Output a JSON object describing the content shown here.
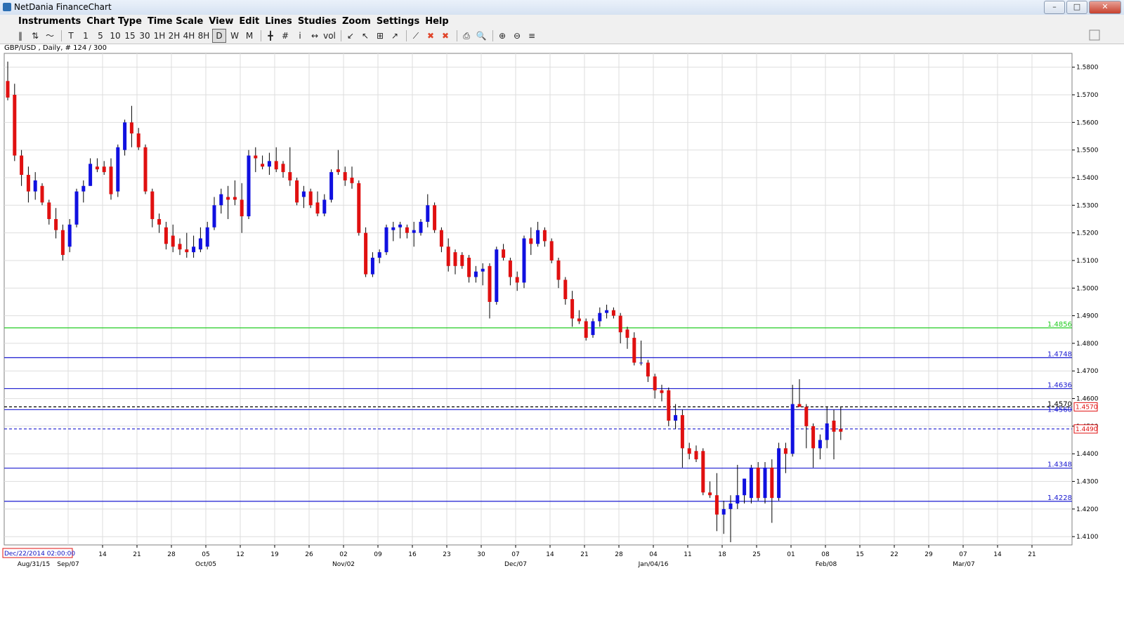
{
  "window": {
    "title": "NetDania FinanceChart",
    "buttons": [
      "–",
      "□",
      "✕"
    ]
  },
  "menu": [
    "Instruments",
    "Chart Type",
    "Time Scale",
    "View",
    "Edit",
    "Lines",
    "Studies",
    "Zoom",
    "Settings",
    "Help"
  ],
  "toolbar": {
    "items": [
      "‖",
      "⇅",
      "〜",
      "|",
      "T",
      "1",
      "5",
      "10",
      "15",
      "30",
      "1H",
      "2H",
      "4H",
      "8H",
      "D",
      "W",
      "M",
      "|",
      "╋",
      "#",
      "i",
      "↔",
      "vol",
      "|",
      "↙",
      "↖",
      "⊞",
      "↗",
      "|",
      "⟋",
      "✖",
      "✖",
      "|",
      "⎙",
      "🔍",
      "|",
      "⊕",
      "⊖",
      "≡"
    ],
    "selected": [
      "D"
    ]
  },
  "symbol_label": "GBP/USD , Daily, # 124 / 300",
  "colors": {
    "up": "#1010e0",
    "down": "#e01010",
    "green": "#22cc22",
    "line": "#1a1ad0",
    "grid": "#dedede"
  },
  "chart_data": {
    "type": "candlestick",
    "y_ticks": [
      "1.5800",
      "1.5700",
      "1.5600",
      "1.5500",
      "1.5400",
      "1.5300",
      "1.5200",
      "1.5100",
      "1.5000",
      "1.4900",
      "1.4800",
      "1.4700",
      "1.4600",
      "1.4500",
      "1.4400",
      "1.4300",
      "1.4200",
      "1.4100"
    ],
    "ylim": [
      1.407,
      1.585
    ],
    "x_tick_labels": [
      "14",
      "21",
      "28",
      "05",
      "12",
      "19",
      "26",
      "02",
      "09",
      "16",
      "23",
      "30",
      "07",
      "14",
      "21",
      "28",
      "04",
      "11",
      "18",
      "25",
      "01",
      "08",
      "15",
      "22",
      "29",
      "07",
      "14",
      "21"
    ],
    "x_period_labels": [
      "Aug/31/15",
      "Sep/07",
      "Oct/05",
      "Nov/02",
      "Dec/07",
      "Jan/04/16",
      "Feb/08",
      "Mar/07"
    ],
    "crosshair_time_label": "Dec/22/2014 02:00:00",
    "horizontal_lines": [
      {
        "value": 1.4856,
        "label": "1.4856",
        "style": "green"
      },
      {
        "value": 1.4748,
        "label": "1.4748",
        "style": "solid"
      },
      {
        "value": 1.4636,
        "label": "1.4636",
        "style": "solid"
      },
      {
        "value": 1.457,
        "label": "1.4570",
        "style": "dashed-black"
      },
      {
        "value": 1.456,
        "label": "1.4560",
        "style": "solid"
      },
      {
        "value": 1.449,
        "label": "1.4490",
        "style": "dashed-blue"
      },
      {
        "value": 1.4348,
        "label": "1.4348",
        "style": "solid"
      },
      {
        "value": 1.4228,
        "label": "1.4228",
        "style": "solid"
      }
    ],
    "price_tags": [
      {
        "value": 1.457,
        "label": "1.4570"
      },
      {
        "value": 1.449,
        "label": "1.4490"
      }
    ],
    "candles": [
      {
        "o": 1.575,
        "h": 1.582,
        "l": 1.568,
        "c": 1.569
      },
      {
        "o": 1.57,
        "h": 1.574,
        "l": 1.546,
        "c": 1.548
      },
      {
        "o": 1.548,
        "h": 1.55,
        "l": 1.537,
        "c": 1.541
      },
      {
        "o": 1.541,
        "h": 1.544,
        "l": 1.531,
        "c": 1.535
      },
      {
        "o": 1.535,
        "h": 1.542,
        "l": 1.532,
        "c": 1.539
      },
      {
        "o": 1.537,
        "h": 1.538,
        "l": 1.53,
        "c": 1.531
      },
      {
        "o": 1.531,
        "h": 1.532,
        "l": 1.523,
        "c": 1.525
      },
      {
        "o": 1.525,
        "h": 1.529,
        "l": 1.518,
        "c": 1.521
      },
      {
        "o": 1.521,
        "h": 1.523,
        "l": 1.51,
        "c": 1.512
      },
      {
        "o": 1.515,
        "h": 1.525,
        "l": 1.513,
        "c": 1.523
      },
      {
        "o": 1.523,
        "h": 1.536,
        "l": 1.522,
        "c": 1.535
      },
      {
        "o": 1.535,
        "h": 1.539,
        "l": 1.531,
        "c": 1.537
      },
      {
        "o": 1.537,
        "h": 1.547,
        "l": 1.537,
        "c": 1.545
      },
      {
        "o": 1.544,
        "h": 1.547,
        "l": 1.542,
        "c": 1.543
      },
      {
        "o": 1.544,
        "h": 1.546,
        "l": 1.541,
        "c": 1.542
      },
      {
        "o": 1.544,
        "h": 1.547,
        "l": 1.532,
        "c": 1.534
      },
      {
        "o": 1.535,
        "h": 1.552,
        "l": 1.533,
        "c": 1.551
      },
      {
        "o": 1.55,
        "h": 1.561,
        "l": 1.548,
        "c": 1.56
      },
      {
        "o": 1.56,
        "h": 1.566,
        "l": 1.551,
        "c": 1.556
      },
      {
        "o": 1.556,
        "h": 1.558,
        "l": 1.55,
        "c": 1.551
      },
      {
        "o": 1.551,
        "h": 1.552,
        "l": 1.534,
        "c": 1.535
      },
      {
        "o": 1.535,
        "h": 1.536,
        "l": 1.522,
        "c": 1.525
      },
      {
        "o": 1.525,
        "h": 1.527,
        "l": 1.52,
        "c": 1.523
      },
      {
        "o": 1.522,
        "h": 1.524,
        "l": 1.514,
        "c": 1.516
      },
      {
        "o": 1.519,
        "h": 1.523,
        "l": 1.513,
        "c": 1.515
      },
      {
        "o": 1.516,
        "h": 1.518,
        "l": 1.512,
        "c": 1.514
      },
      {
        "o": 1.514,
        "h": 1.52,
        "l": 1.511,
        "c": 1.513
      },
      {
        "o": 1.513,
        "h": 1.519,
        "l": 1.511,
        "c": 1.515
      },
      {
        "o": 1.514,
        "h": 1.522,
        "l": 1.513,
        "c": 1.518
      },
      {
        "o": 1.515,
        "h": 1.524,
        "l": 1.514,
        "c": 1.522
      },
      {
        "o": 1.522,
        "h": 1.533,
        "l": 1.521,
        "c": 1.53
      },
      {
        "o": 1.53,
        "h": 1.536,
        "l": 1.527,
        "c": 1.534
      },
      {
        "o": 1.533,
        "h": 1.537,
        "l": 1.525,
        "c": 1.532
      },
      {
        "o": 1.533,
        "h": 1.539,
        "l": 1.53,
        "c": 1.532
      },
      {
        "o": 1.532,
        "h": 1.538,
        "l": 1.52,
        "c": 1.526
      },
      {
        "o": 1.526,
        "h": 1.55,
        "l": 1.525,
        "c": 1.548
      },
      {
        "o": 1.548,
        "h": 1.551,
        "l": 1.542,
        "c": 1.547
      },
      {
        "o": 1.545,
        "h": 1.548,
        "l": 1.543,
        "c": 1.544
      },
      {
        "o": 1.544,
        "h": 1.549,
        "l": 1.541,
        "c": 1.546
      },
      {
        "o": 1.546,
        "h": 1.551,
        "l": 1.542,
        "c": 1.543
      },
      {
        "o": 1.545,
        "h": 1.546,
        "l": 1.54,
        "c": 1.542
      },
      {
        "o": 1.542,
        "h": 1.551,
        "l": 1.537,
        "c": 1.539
      },
      {
        "o": 1.539,
        "h": 1.54,
        "l": 1.53,
        "c": 1.531
      },
      {
        "o": 1.533,
        "h": 1.537,
        "l": 1.529,
        "c": 1.535
      },
      {
        "o": 1.535,
        "h": 1.536,
        "l": 1.529,
        "c": 1.53
      },
      {
        "o": 1.531,
        "h": 1.535,
        "l": 1.526,
        "c": 1.527
      },
      {
        "o": 1.527,
        "h": 1.534,
        "l": 1.526,
        "c": 1.532
      },
      {
        "o": 1.532,
        "h": 1.543,
        "l": 1.531,
        "c": 1.542
      },
      {
        "o": 1.543,
        "h": 1.55,
        "l": 1.541,
        "c": 1.542
      },
      {
        "o": 1.542,
        "h": 1.544,
        "l": 1.537,
        "c": 1.539
      },
      {
        "o": 1.54,
        "h": 1.544,
        "l": 1.536,
        "c": 1.538
      },
      {
        "o": 1.538,
        "h": 1.539,
        "l": 1.519,
        "c": 1.52
      },
      {
        "o": 1.52,
        "h": 1.522,
        "l": 1.504,
        "c": 1.505
      },
      {
        "o": 1.505,
        "h": 1.513,
        "l": 1.504,
        "c": 1.511
      },
      {
        "o": 1.511,
        "h": 1.514,
        "l": 1.509,
        "c": 1.513
      },
      {
        "o": 1.513,
        "h": 1.523,
        "l": 1.512,
        "c": 1.522
      },
      {
        "o": 1.521,
        "h": 1.524,
        "l": 1.517,
        "c": 1.522
      },
      {
        "o": 1.522,
        "h": 1.524,
        "l": 1.518,
        "c": 1.523
      },
      {
        "o": 1.522,
        "h": 1.523,
        "l": 1.518,
        "c": 1.52
      },
      {
        "o": 1.52,
        "h": 1.524,
        "l": 1.515,
        "c": 1.521
      },
      {
        "o": 1.52,
        "h": 1.525,
        "l": 1.519,
        "c": 1.524
      },
      {
        "o": 1.524,
        "h": 1.534,
        "l": 1.522,
        "c": 1.53
      },
      {
        "o": 1.53,
        "h": 1.531,
        "l": 1.52,
        "c": 1.521
      },
      {
        "o": 1.521,
        "h": 1.522,
        "l": 1.513,
        "c": 1.515
      },
      {
        "o": 1.515,
        "h": 1.518,
        "l": 1.506,
        "c": 1.508
      },
      {
        "o": 1.513,
        "h": 1.514,
        "l": 1.505,
        "c": 1.508
      },
      {
        "o": 1.512,
        "h": 1.513,
        "l": 1.507,
        "c": 1.508
      },
      {
        "o": 1.511,
        "h": 1.512,
        "l": 1.502,
        "c": 1.504
      },
      {
        "o": 1.504,
        "h": 1.508,
        "l": 1.502,
        "c": 1.506
      },
      {
        "o": 1.506,
        "h": 1.509,
        "l": 1.501,
        "c": 1.507
      },
      {
        "o": 1.508,
        "h": 1.509,
        "l": 1.489,
        "c": 1.495
      },
      {
        "o": 1.495,
        "h": 1.515,
        "l": 1.494,
        "c": 1.514
      },
      {
        "o": 1.514,
        "h": 1.516,
        "l": 1.51,
        "c": 1.511
      },
      {
        "o": 1.51,
        "h": 1.511,
        "l": 1.501,
        "c": 1.504
      },
      {
        "o": 1.504,
        "h": 1.506,
        "l": 1.499,
        "c": 1.502
      },
      {
        "o": 1.502,
        "h": 1.519,
        "l": 1.5,
        "c": 1.518
      },
      {
        "o": 1.518,
        "h": 1.522,
        "l": 1.512,
        "c": 1.516
      },
      {
        "o": 1.516,
        "h": 1.524,
        "l": 1.515,
        "c": 1.521
      },
      {
        "o": 1.521,
        "h": 1.522,
        "l": 1.515,
        "c": 1.517
      },
      {
        "o": 1.517,
        "h": 1.518,
        "l": 1.509,
        "c": 1.51
      },
      {
        "o": 1.51,
        "h": 1.511,
        "l": 1.5,
        "c": 1.503
      },
      {
        "o": 1.503,
        "h": 1.504,
        "l": 1.494,
        "c": 1.496
      },
      {
        "o": 1.496,
        "h": 1.499,
        "l": 1.486,
        "c": 1.489
      },
      {
        "o": 1.489,
        "h": 1.492,
        "l": 1.487,
        "c": 1.488
      },
      {
        "o": 1.488,
        "h": 1.489,
        "l": 1.481,
        "c": 1.482
      },
      {
        "o": 1.483,
        "h": 1.489,
        "l": 1.482,
        "c": 1.488
      },
      {
        "o": 1.488,
        "h": 1.493,
        "l": 1.486,
        "c": 1.491
      },
      {
        "o": 1.491,
        "h": 1.494,
        "l": 1.489,
        "c": 1.492
      },
      {
        "o": 1.492,
        "h": 1.493,
        "l": 1.489,
        "c": 1.49
      },
      {
        "o": 1.49,
        "h": 1.491,
        "l": 1.48,
        "c": 1.484
      },
      {
        "o": 1.485,
        "h": 1.486,
        "l": 1.478,
        "c": 1.482
      },
      {
        "o": 1.482,
        "h": 1.484,
        "l": 1.472,
        "c": 1.473
      },
      {
        "o": 1.473,
        "h": 1.481,
        "l": 1.472,
        "c": 1.473
      },
      {
        "o": 1.473,
        "h": 1.474,
        "l": 1.466,
        "c": 1.468
      },
      {
        "o": 1.468,
        "h": 1.469,
        "l": 1.46,
        "c": 1.463
      },
      {
        "o": 1.463,
        "h": 1.465,
        "l": 1.459,
        "c": 1.462
      },
      {
        "o": 1.463,
        "h": 1.464,
        "l": 1.45,
        "c": 1.452
      },
      {
        "o": 1.452,
        "h": 1.458,
        "l": 1.449,
        "c": 1.454
      },
      {
        "o": 1.454,
        "h": 1.456,
        "l": 1.435,
        "c": 1.442
      },
      {
        "o": 1.442,
        "h": 1.444,
        "l": 1.438,
        "c": 1.44
      },
      {
        "o": 1.441,
        "h": 1.443,
        "l": 1.437,
        "c": 1.438
      },
      {
        "o": 1.441,
        "h": 1.442,
        "l": 1.425,
        "c": 1.426
      },
      {
        "o": 1.426,
        "h": 1.43,
        "l": 1.424,
        "c": 1.425
      },
      {
        "o": 1.425,
        "h": 1.433,
        "l": 1.412,
        "c": 1.418
      },
      {
        "o": 1.418,
        "h": 1.423,
        "l": 1.411,
        "c": 1.42
      },
      {
        "o": 1.42,
        "h": 1.425,
        "l": 1.408,
        "c": 1.422
      },
      {
        "o": 1.422,
        "h": 1.436,
        "l": 1.42,
        "c": 1.425
      },
      {
        "o": 1.425,
        "h": 1.431,
        "l": 1.422,
        "c": 1.431
      },
      {
        "o": 1.424,
        "h": 1.436,
        "l": 1.422,
        "c": 1.435
      },
      {
        "o": 1.435,
        "h": 1.437,
        "l": 1.423,
        "c": 1.424
      },
      {
        "o": 1.424,
        "h": 1.437,
        "l": 1.422,
        "c": 1.435
      },
      {
        "o": 1.435,
        "h": 1.438,
        "l": 1.415,
        "c": 1.424
      },
      {
        "o": 1.424,
        "h": 1.444,
        "l": 1.423,
        "c": 1.442
      },
      {
        "o": 1.442,
        "h": 1.444,
        "l": 1.433,
        "c": 1.44
      },
      {
        "o": 1.44,
        "h": 1.465,
        "l": 1.439,
        "c": 1.458
      },
      {
        "o": 1.458,
        "h": 1.467,
        "l": 1.457,
        "c": 1.457
      },
      {
        "o": 1.457,
        "h": 1.458,
        "l": 1.442,
        "c": 1.45
      },
      {
        "o": 1.45,
        "h": 1.451,
        "l": 1.435,
        "c": 1.442
      },
      {
        "o": 1.442,
        "h": 1.447,
        "l": 1.438,
        "c": 1.445
      },
      {
        "o": 1.445,
        "h": 1.457,
        "l": 1.442,
        "c": 1.451
      },
      {
        "o": 1.452,
        "h": 1.456,
        "l": 1.438,
        "c": 1.448
      },
      {
        "o": 1.449,
        "h": 1.457,
        "l": 1.445,
        "c": 1.448
      }
    ]
  }
}
